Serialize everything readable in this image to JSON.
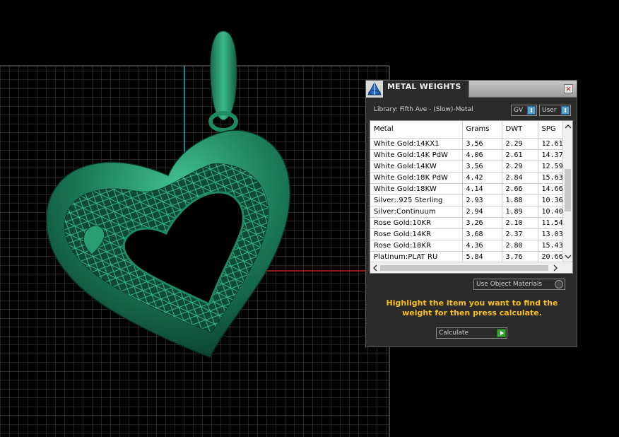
{
  "panel": {
    "title": "METAL WEIGHTS",
    "close_label": "×",
    "library_label": "Library: Fifth Ave - (Slow)-Metal",
    "gv_toggle": "GV",
    "user_toggle": "User",
    "columns": [
      "Metal",
      "Grams",
      "DWT",
      "SPG"
    ],
    "rows": [
      [
        "White Gold:14KX1",
        "3.56",
        "2.29",
        "12.61"
      ],
      [
        "White Gold:14K PdW",
        "4.06",
        "2.61",
        "14.37"
      ],
      [
        "White Gold:14KW",
        "3.56",
        "2.29",
        "12.59"
      ],
      [
        "White Gold:18K PdW",
        "4.42",
        "2.84",
        "15.63"
      ],
      [
        "White Gold:18KW",
        "4.14",
        "2.66",
        "14.66"
      ],
      [
        "Silver:.925 Sterling",
        "2.93",
        "1.88",
        "10.36"
      ],
      [
        "Silver:Continuum",
        "2.94",
        "1.89",
        "10.40"
      ],
      [
        "Rose Gold:10KR",
        "3.26",
        "2.10",
        "11.54"
      ],
      [
        "Rose Gold:14KR",
        "3.68",
        "2.37",
        "13.03"
      ],
      [
        "Rose Gold:18KR",
        "4.36",
        "2.80",
        "15.43"
      ],
      [
        "Platinum:PLAT RU",
        "5.84",
        "3.76",
        "20.66"
      ]
    ],
    "use_object_materials": "Use Object Materials",
    "hint": "Highlight the item you want to find the weight for then press calculate.",
    "calculate_label": "Calculate"
  },
  "colors": {
    "model_green": "#1f8a66",
    "grid": "#6a6a6a",
    "hint": "#f5c020"
  }
}
